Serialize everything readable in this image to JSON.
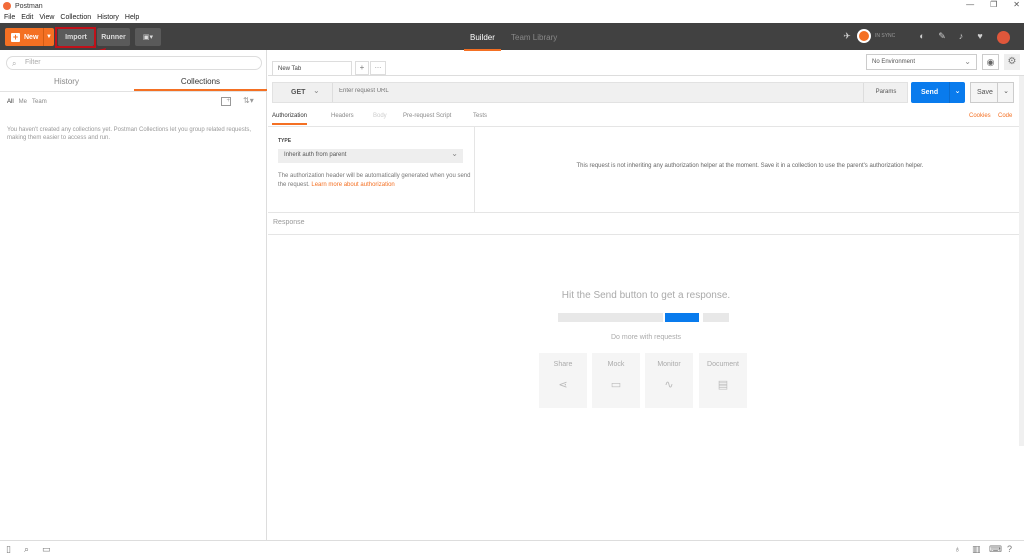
{
  "window": {
    "title": "Postman",
    "controls": [
      "—",
      "❐",
      "✕"
    ]
  },
  "menu": [
    "File",
    "Edit",
    "View",
    "Collection",
    "History",
    "Help"
  ],
  "toolbar": {
    "new_label": "New",
    "import_label": "Import",
    "runner_label": "Runner",
    "builder_tab": "Builder",
    "team_library_tab": "Team Library",
    "sync_label": "IN SYNC",
    "accent_color": "#f47023",
    "highlight_color": "#c0111a"
  },
  "sidebar": {
    "filter_placeholder": "Filter",
    "tabs": [
      "History",
      "Collections"
    ],
    "active_tab": "Collections",
    "subfilters": [
      "All",
      "Me",
      "Team"
    ],
    "empty_message": "You haven't created any collections yet. Postman Collections let you group related requests, making them easier to access and run."
  },
  "request": {
    "tab_label": "New Tab",
    "environment": "No Environment",
    "method": "GET",
    "url_placeholder": "Enter request URL",
    "params_label": "Params",
    "send_label": "Send",
    "save_label": "Save",
    "tabs": [
      "Authorization",
      "Headers",
      "Body",
      "Pre-request Script",
      "Tests"
    ],
    "active_tab": "Authorization",
    "cookies_link": "Cookies",
    "code_link": "Code"
  },
  "auth": {
    "type_label": "TYPE",
    "type_value": "Inherit auth from parent",
    "description": "The authorization header will be automatically generated when you send the request.",
    "learn_more": "Learn more about authorization",
    "message": "This request is not inheriting any authorization helper at the moment. Save it in a collection to use the parent's authorization helper."
  },
  "response": {
    "label": "Response",
    "empty_title": "Hit the Send button to get a response.",
    "do_more": "Do more with requests",
    "cards": [
      "Share",
      "Mock",
      "Monitor",
      "Document"
    ]
  }
}
